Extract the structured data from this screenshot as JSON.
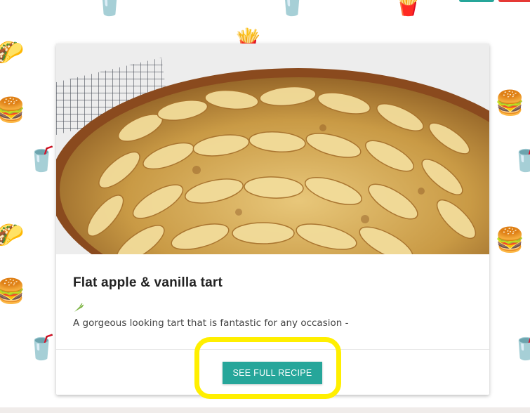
{
  "recipe": {
    "title": "Flat apple & vanilla tart",
    "description": "A gorgeous looking tart that is fantastic for any occasion -",
    "button_label": "SEE FULL RECIPE",
    "diet_icon": "carrot-icon"
  },
  "background": {
    "pattern_icons": [
      "taco-icon",
      "burger-icon",
      "drink-cup-icon",
      "fries-icon"
    ]
  },
  "colors": {
    "accent": "#26a69a",
    "highlight": "#ffef00",
    "danger": "#e53935",
    "diet_icon": "#7cb342"
  }
}
